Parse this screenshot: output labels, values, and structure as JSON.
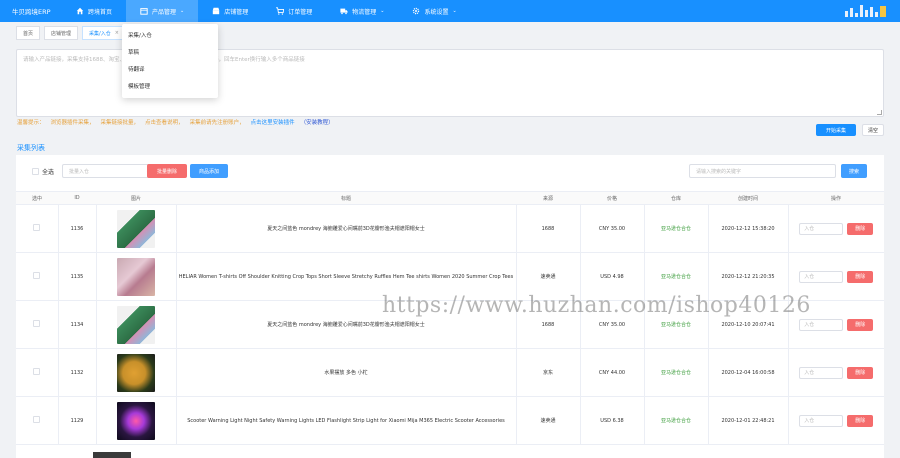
{
  "app": {
    "brand": "牛贝跨境ERP"
  },
  "nav": [
    {
      "label": "跨境首页",
      "icon": "home-icon"
    },
    {
      "label": "产品管理",
      "icon": "box-icon",
      "active": true
    },
    {
      "label": "店铺管理",
      "icon": "store-icon"
    },
    {
      "label": "订单管理",
      "icon": "cart-icon"
    },
    {
      "label": "物流管理",
      "icon": "truck-icon"
    },
    {
      "label": "系统设置",
      "icon": "gear-icon"
    }
  ],
  "tabs": [
    {
      "label": "首页"
    },
    {
      "label": "店铺管理"
    },
    {
      "label": "采集/入仓",
      "active": true,
      "close": "×"
    }
  ],
  "dropdown": {
    "items": [
      "采集/入仓",
      "草稿",
      "待翻译",
      "模板管理"
    ]
  },
  "collect": {
    "placeholder": "请输入产品链接，采集支持1688、淘宝、天猫、速卖通、亚马逊等平台产品链接，回车Enter换行输入多个商品链接",
    "tips": {
      "prefix": "温馨提示：",
      "t1": "浏览器插件采集，",
      "t2": "采集链接批量，",
      "t3": "点击查看说明，",
      "t4": "采集前请先注册账户，",
      "link1": "点击这里安装插件",
      "link2": "（安装教程）"
    },
    "start_btn": "开始采集",
    "clear_btn": "清空"
  },
  "list": {
    "title": "采集列表",
    "select_all": "全选",
    "batch_placeholder": "批量入仓",
    "batch_delete": "批量删除",
    "add_product": "商品添加",
    "search_placeholder": "请输入搜索的关键字",
    "search_btn": "搜索",
    "headers": [
      "选中",
      "ID",
      "图片",
      "标题",
      "来源",
      "价格",
      "仓库",
      "创建时间",
      "操作"
    ],
    "rows": [
      {
        "id": "1136",
        "title": "夏天之间蓝色 mondrey 海鲍雕爱心间嘴前3D花瓣形渔夫帽遮阳帽女士",
        "source": "1688",
        "price": "CNY 35.00",
        "warehouse": "亚马逊仓合仓",
        "time": "2020-12-12 15:38:20",
        "status": "入仓"
      },
      {
        "id": "1135",
        "title": "HELIAR Women T-shirts Off Shoulder Knitting Crop Tops Short Sleeve Stretchy Ruffles Hem Tee shirts Women 2020 Summer Crop Tees",
        "source": "速卖通",
        "price": "USD 4.98",
        "warehouse": "亚马逊仓合仓",
        "time": "2020-12-12 21:20:35",
        "status": "入仓"
      },
      {
        "id": "1134",
        "title": "夏天之间蓝色 mondrey 海鲍雕爱心间嘴前3D花瓣形渔夫帽遮阳帽女士",
        "source": "1688",
        "price": "CNY 35.00",
        "warehouse": "亚马逊仓合仓",
        "time": "2020-12-10 20:07:41",
        "status": "入仓"
      },
      {
        "id": "1132",
        "title": "水果摆放 多色 小杧",
        "source": "京东",
        "price": "CNY 44.00",
        "warehouse": "亚马逊仓合仓",
        "time": "2020-12-04 16:00:58",
        "status": "入仓"
      },
      {
        "id": "1129",
        "title": "Scooter Warning Light Night Safety Warning Lights LED Flashlight Strip Light for Xiaomi Mija M365 Electric Scooter Accessories",
        "source": "速卖通",
        "price": "USD 6.38",
        "warehouse": "亚马逊仓合仓",
        "time": "2020-12-01 22:48:21",
        "status": "入仓"
      }
    ],
    "delete_label": "删除"
  },
  "watermark": "https://www.huzhan.com/ishop40126"
}
